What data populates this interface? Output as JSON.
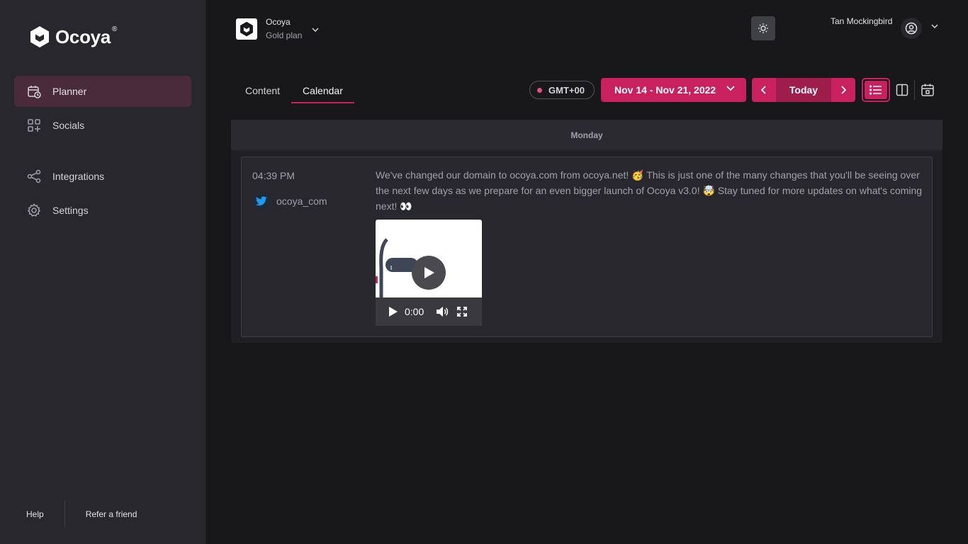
{
  "sidebar": {
    "logo_text": "Ocoya",
    "logo_reg": "®",
    "items": [
      {
        "label": "Planner",
        "icon": "calendar-clock-icon",
        "active": true
      },
      {
        "label": "Socials",
        "icon": "grid-plus-icon",
        "active": false
      },
      {
        "label": "Integrations",
        "icon": "share-nodes-icon",
        "active": false
      },
      {
        "label": "Settings",
        "icon": "gear-icon",
        "active": false
      }
    ],
    "footer": {
      "help": "Help",
      "refer": "Refer a friend"
    }
  },
  "header": {
    "workspace_name": "Ocoya",
    "workspace_plan": "Gold plan",
    "user_name": "Tan Mockingbird"
  },
  "tabs": [
    {
      "label": "Content",
      "active": false
    },
    {
      "label": "Calendar",
      "active": true
    }
  ],
  "toolbar": {
    "timezone": "GMT+00",
    "date_range": "Nov 14 - Nov 21, 2022",
    "today": "Today"
  },
  "calendar": {
    "day": "Monday",
    "posts": [
      {
        "time": "04:39 PM",
        "network_icon": "twitter-icon",
        "account": "ocoya_com",
        "text": "We've changed our domain to ocoya.com from ocoya.net! 🥳 This is just one of the many changes that you'll be seeing over the next few days as we prepare for an even bigger launch of Ocoya v3.0! 🤯 Stay tuned for more updates on what's coming next! 👀",
        "video_time": "0:00"
      }
    ]
  },
  "colors": {
    "accent": "#c9205e",
    "accent_dark": "#9e1d4b",
    "sidebar_bg": "#27272d",
    "page_bg": "#18181b",
    "active_nav_bg": "#4a2b3b",
    "twitter": "#1d9bf0"
  }
}
